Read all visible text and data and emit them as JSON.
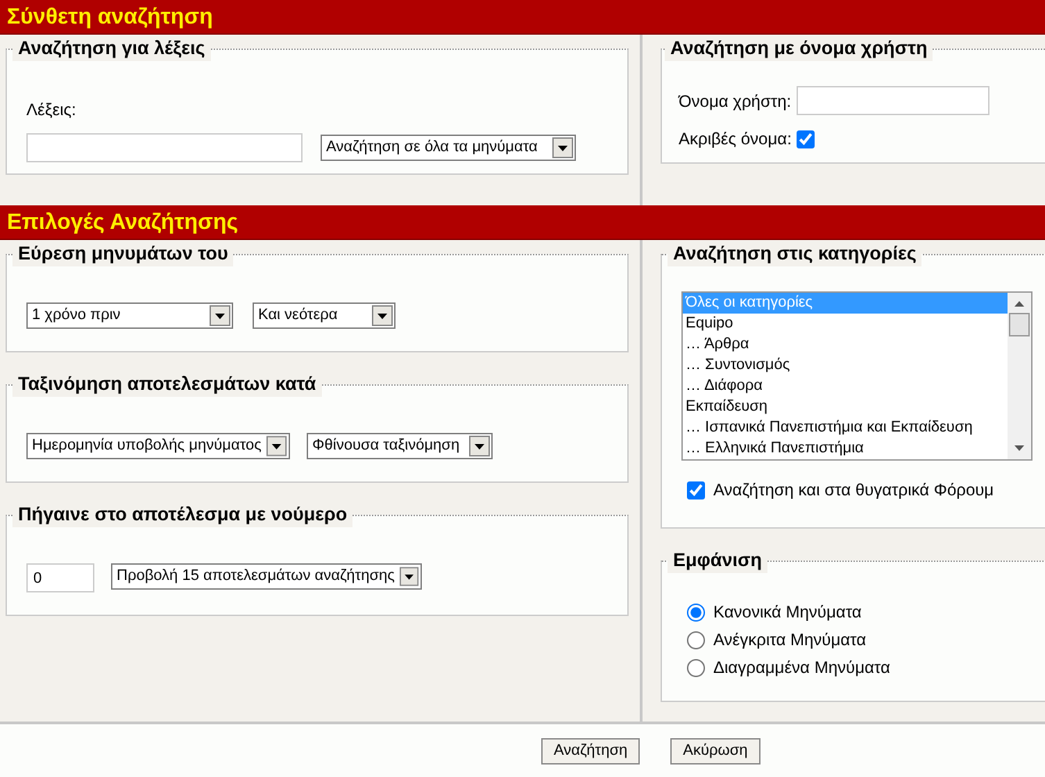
{
  "advanced_search": {
    "title": "Σύνθετη αναζήτηση",
    "keywords": {
      "legend": "Αναζήτηση για λέξεις",
      "label": "Λέξεις:",
      "scope_select": "Αναζήτηση σε όλα τα μηνύματα"
    },
    "username": {
      "legend": "Αναζήτηση με όνομα χρήστη",
      "label": "Όνομα χρήστη:",
      "exact_label": "Ακριβές όνομα:",
      "exact_checked": true
    }
  },
  "search_options": {
    "title": "Επιλογές Αναζήτησης",
    "find_posts": {
      "legend": "Εύρεση μηνυμάτων του",
      "selects": [
        "1 χρόνο πριν",
        "Και νεότερα"
      ]
    },
    "sort": {
      "legend": "Ταξινόμηση αποτελεσμάτων κατά",
      "selects": [
        "Ημερομηνία υποβολής μηνύματος",
        "Φθίνουσα ταξινόμηση"
      ]
    },
    "goto": {
      "legend": "Πήγαινε στο αποτέλεσμα με νούμερο",
      "value": "0",
      "select": "Προβολή 15 αποτελεσμάτων αναζήτησης"
    },
    "categories": {
      "legend": "Αναζήτηση στις κατηγορίες",
      "items": [
        {
          "label": "Όλες οι κατηγορίες",
          "selected": true
        },
        {
          "label": "Equipo",
          "selected": false
        },
        {
          "label": "… Άρθρα",
          "selected": false
        },
        {
          "label": "… Συντονισμός",
          "selected": false
        },
        {
          "label": "… Διάφορα",
          "selected": false
        },
        {
          "label": "Εκπαίδευση",
          "selected": false
        },
        {
          "label": "… Ισπανικά Πανεπιστήμια και Εκπαίδευση",
          "selected": false
        },
        {
          "label": "… Ελληνικά Πανεπιστήμια",
          "selected": false
        }
      ],
      "subforums_label": "Αναζήτηση και στα θυγατρικά Φόρουμ",
      "subforums_checked": true
    },
    "display": {
      "legend": "Εμφάνιση",
      "options": [
        {
          "label": "Κανονικά Μηνύματα",
          "selected": true
        },
        {
          "label": "Ανέγκριτα Μηνύματα",
          "selected": false
        },
        {
          "label": "Διαγραμμένα Μηνύματα",
          "selected": false
        }
      ]
    }
  },
  "buttons": [
    "Αναζήτηση",
    "Ακύρωση"
  ]
}
